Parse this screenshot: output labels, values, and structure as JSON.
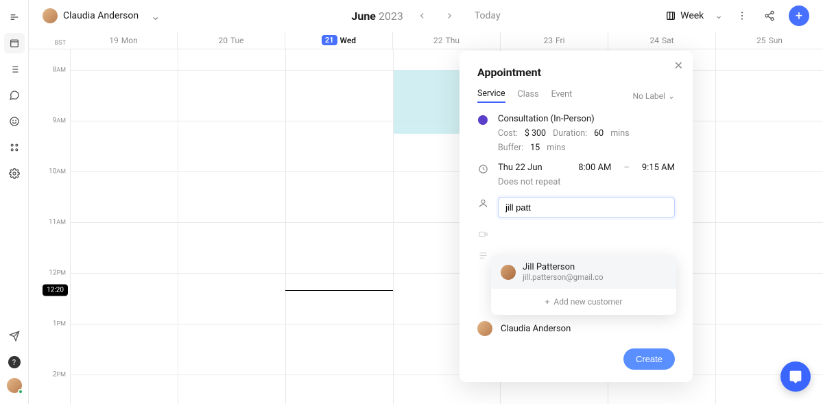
{
  "user": {
    "name": "Claudia Anderson"
  },
  "header": {
    "month": "June",
    "year": "2023",
    "today_label": "Today",
    "view_label": "Week"
  },
  "timezone": "BST",
  "days": [
    {
      "num": "19",
      "name": "Mon",
      "today": false
    },
    {
      "num": "20",
      "name": "Tue",
      "today": false
    },
    {
      "num": "21",
      "name": "Wed",
      "today": true
    },
    {
      "num": "22",
      "name": "Thu",
      "today": false
    },
    {
      "num": "23",
      "name": "Fri",
      "today": false
    },
    {
      "num": "24",
      "name": "Sat",
      "today": false
    },
    {
      "num": "25",
      "name": "Sun",
      "today": false
    }
  ],
  "hours": [
    "8AM",
    "9AM",
    "10AM",
    "11AM",
    "12PM",
    "1PM",
    "2PM"
  ],
  "now": "12:20",
  "panel": {
    "title": "Appointment",
    "tabs": {
      "service": "Service",
      "class": "Class",
      "event": "Event"
    },
    "label_picker": "No Label",
    "service_name": "Consultation (In-Person)",
    "cost_label": "Cost:",
    "cost_currency": "$",
    "cost_value": "300",
    "duration_label": "Duration:",
    "duration_value": "60",
    "duration_unit": "mins",
    "buffer_label": "Buffer:",
    "buffer_value": "15",
    "buffer_unit": "mins",
    "date": "Thu 22 Jun",
    "start": "8:00 AM",
    "dash": "–",
    "end": "9:15 AM",
    "repeat": "Does not repeat",
    "customer_query": "jill patt",
    "suggestion_name": "Jill Patterson",
    "suggestion_email": "jill.patterson@gmail.co",
    "add_new": "Add new customer",
    "team_member": "Claudia Anderson",
    "create": "Create"
  },
  "colors": {
    "primary": "#4870ff",
    "service_dot": "#5b3ec9",
    "highlight": "#c9ecf0"
  }
}
